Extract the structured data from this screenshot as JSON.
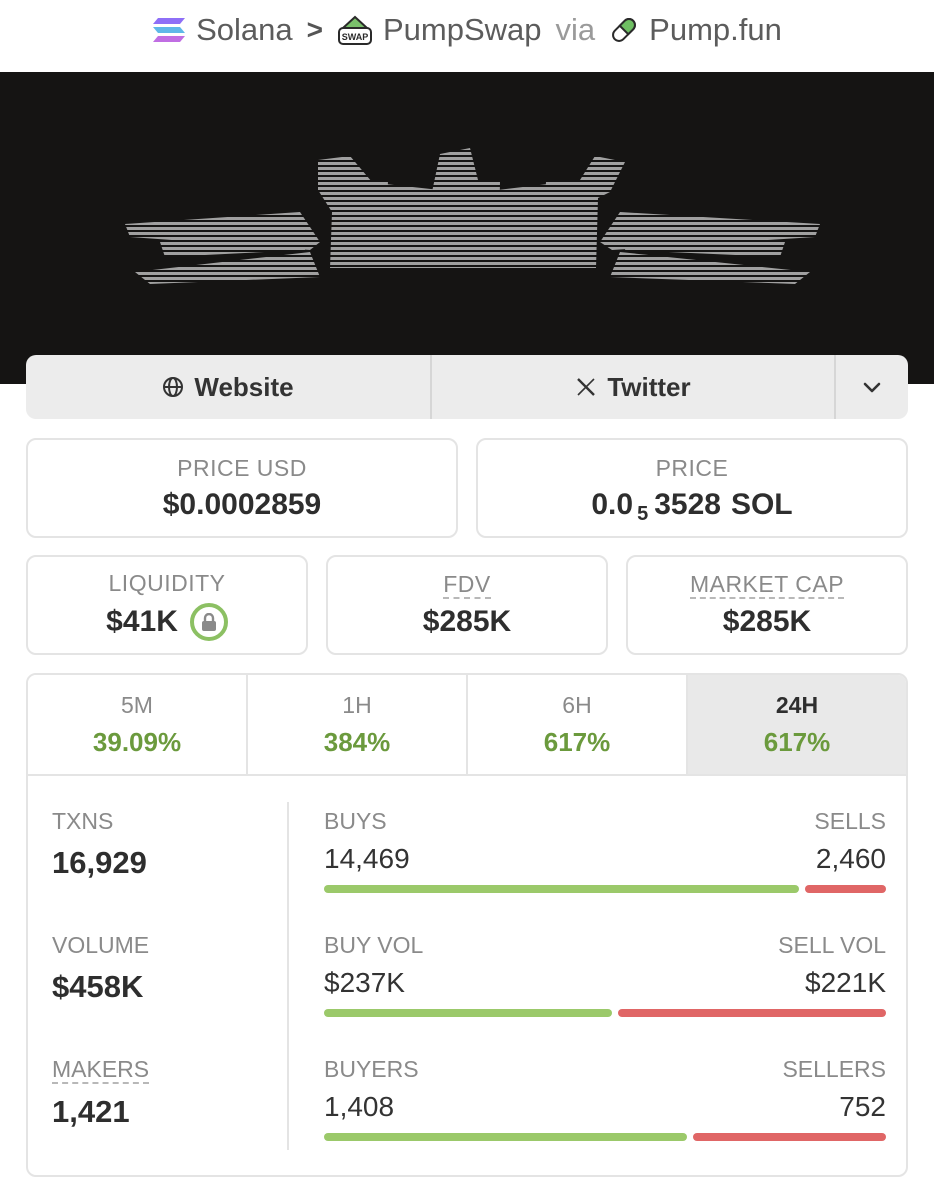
{
  "breadcrumb": {
    "chain": "Solana",
    "separator": ">",
    "dex": "PumpSwap",
    "dex_badge": "SWAP",
    "via": "via",
    "launchpad": "Pump.fun"
  },
  "links": {
    "website_label": "Website",
    "twitter_label": "Twitter"
  },
  "price_usd": {
    "label": "PRICE USD",
    "value": "$0.0002859"
  },
  "price_native": {
    "label": "PRICE",
    "prefix": "0.0",
    "zeros_subscript": "5",
    "digits": "3528",
    "unit": "SOL"
  },
  "liquidity": {
    "label": "LIQUIDITY",
    "value": "$41K",
    "locked": true
  },
  "fdv": {
    "label": "FDV",
    "value": "$285K"
  },
  "market_cap": {
    "label": "MARKET CAP",
    "value": "$285K"
  },
  "timeframes": [
    {
      "label": "5M",
      "change": "39.09%"
    },
    {
      "label": "1H",
      "change": "384%"
    },
    {
      "label": "6H",
      "change": "617%"
    },
    {
      "label": "24H",
      "change": "617%"
    }
  ],
  "active_timeframe": "24H",
  "metrics": {
    "txns": {
      "label": "TXNS",
      "value": "16,929"
    },
    "volume": {
      "label": "VOLUME",
      "value": "$458K"
    },
    "makers": {
      "label": "MAKERS",
      "value": "1,421"
    }
  },
  "ratios": {
    "txns": {
      "left_label": "BUYS",
      "right_label": "SELLS",
      "left_value": "14,469",
      "right_value": "2,460",
      "buy_share": 0.855
    },
    "volume": {
      "left_label": "BUY VOL",
      "right_label": "SELL VOL",
      "left_value": "$237K",
      "right_value": "$221K",
      "buy_share": 0.518
    },
    "makers": {
      "left_label": "BUYERS",
      "right_label": "SELLERS",
      "left_value": "1,408",
      "right_value": "752",
      "buy_share": 0.652
    }
  },
  "colors": {
    "positive": "#6b9a3d",
    "buy_bar": "#9bc96a",
    "sell_bar": "#e06666",
    "banner_bg": "#151413"
  }
}
